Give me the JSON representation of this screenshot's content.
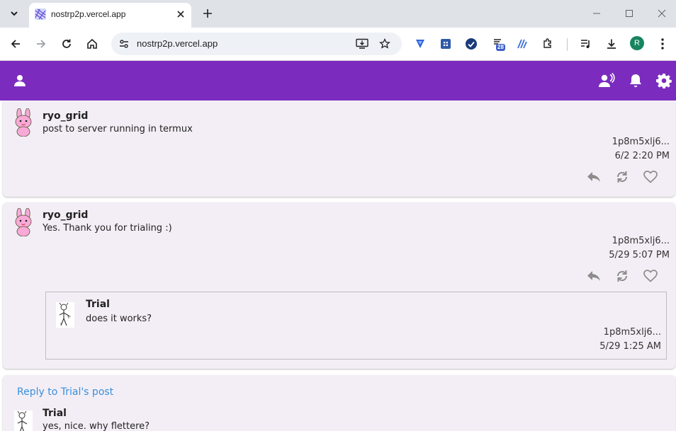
{
  "browser": {
    "tab_title": "nostrp2p.vercel.app",
    "url": "nostrp2p.vercel.app",
    "extension_badge": "28",
    "profile_initial": "R"
  },
  "appbar": {
    "color": "#7b2cbf",
    "icons": [
      "person-icon",
      "contacts-icon",
      "bell-icon",
      "gear-icon"
    ]
  },
  "posts": [
    {
      "author": "ryo_grid",
      "text": "post to server running in termux",
      "pubkey": "1p8m5xlj6...",
      "time": "6/2 2:20 PM"
    },
    {
      "author": "ryo_grid",
      "text": "Yes. Thank you for trialing :)",
      "pubkey": "1p8m5xlj6...",
      "time": "5/29 5:07 PM",
      "quoted": {
        "author": "Trial",
        "text": "does it works?",
        "pubkey": "1p8m5xlj6...",
        "time": "5/29 1:25 AM"
      }
    },
    {
      "reply_label": "Reply to Trial's post",
      "author": "Trial",
      "text": "yes, nice. why flettere?"
    }
  ]
}
